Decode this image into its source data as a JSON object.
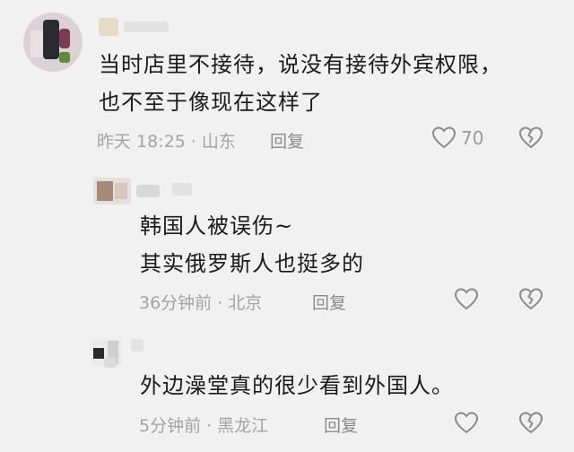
{
  "comments": [
    {
      "text_lines": [
        "当时店里不接待，说没有接待外宾权限，",
        "也不至于像现在这样了"
      ],
      "time": "昨天 18:25",
      "location": "山东",
      "reply_label": "回复",
      "like_count": "70"
    },
    {
      "text_lines": [
        "韩国人被误伤~",
        "其实俄罗斯人也挺多的"
      ],
      "time": "36分钟前",
      "location": "北京",
      "reply_label": "回复"
    },
    {
      "text_lines": [
        "外边澡堂真的很少看到外国人。"
      ],
      "time": "5分钟前",
      "location": "黑龙江",
      "reply_label": "回复"
    }
  ],
  "separator": "·",
  "icons": {
    "like": "heart-outline-icon",
    "dislike": "broken-heart-outline-icon"
  },
  "colors": {
    "background": "#f1f1f1",
    "meta": "#a3a3a3",
    "icon": "#8a8a8a"
  }
}
